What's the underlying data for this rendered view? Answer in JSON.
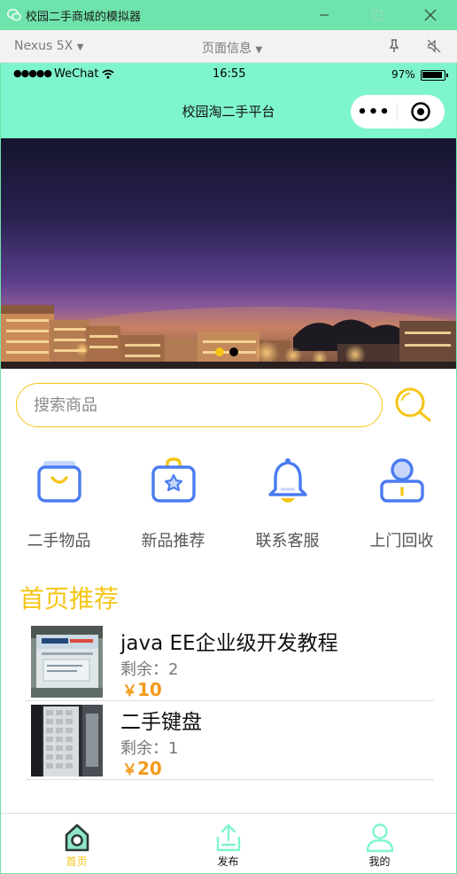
{
  "window": {
    "title": "校园二手商城的模拟器",
    "controls": [
      "minimize-icon",
      "maximize-icon",
      "close-icon"
    ]
  },
  "devtools": {
    "device": "Nexus 5X",
    "page_info": "页面信息"
  },
  "status_bar": {
    "signal": "●●●●●",
    "carrier": "WeChat",
    "time": "16:55",
    "battery": "97%",
    "battery_level": 0.97
  },
  "nav": {
    "title": "校园淘二手平台",
    "more": "•••"
  },
  "banner": {
    "active_dot": 0,
    "dot_count": 2
  },
  "search": {
    "placeholder": "搜索商品"
  },
  "categories": [
    {
      "label": "二手物品",
      "icon": "shopping-bag-icon"
    },
    {
      "label": "新品推荐",
      "icon": "star-bag-icon"
    },
    {
      "label": "联系客服",
      "icon": "bell-icon"
    },
    {
      "label": "上门回收",
      "icon": "user-icon"
    }
  ],
  "section": {
    "title": "首页推荐"
  },
  "products": [
    {
      "name": "java EE企业级开发教程",
      "stock_label": "剩余：",
      "stock": "2",
      "currency": "￥",
      "price": "10"
    },
    {
      "name": "二手键盘",
      "stock_label": "剩余：",
      "stock": "1",
      "currency": "￥",
      "price": "20"
    }
  ],
  "tabs": [
    {
      "label": "首页",
      "icon": "home-icon",
      "active": true
    },
    {
      "label": "发布",
      "icon": "upload-icon",
      "active": false
    },
    {
      "label": "我的",
      "icon": "profile-icon",
      "active": false
    }
  ],
  "colors": {
    "accent": "#f5c518",
    "header": "#7ff5ce",
    "price": "#f39a1b",
    "icon_blue": "#4a7cf0"
  }
}
